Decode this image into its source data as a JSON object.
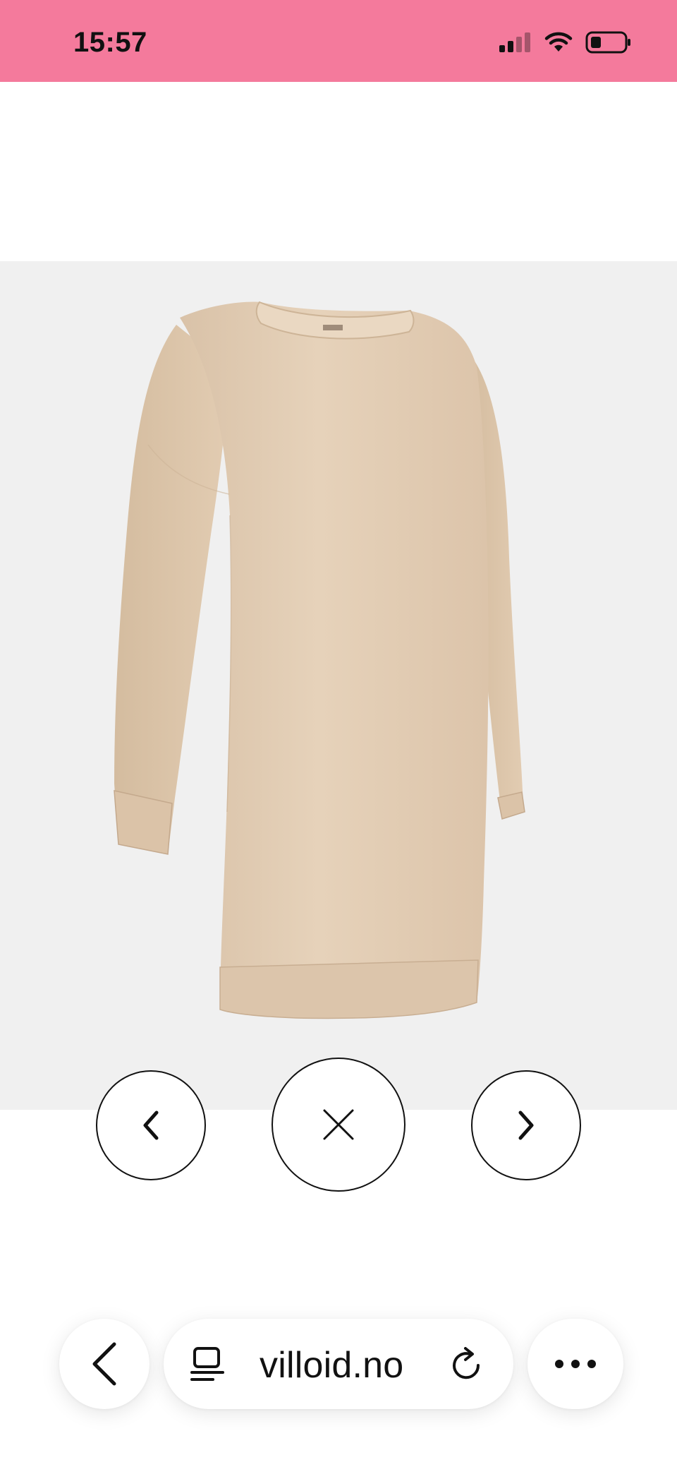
{
  "status_bar": {
    "time": "15:57",
    "background_color": "#f47a9c",
    "icons": [
      "cellular-signal-icon",
      "wifi-icon",
      "battery-icon"
    ]
  },
  "product_viewer": {
    "image": "beige oversized sweatshirt dress, side view",
    "background_color": "#f0f0f0",
    "controls": {
      "previous_icon": "chevron-left-icon",
      "close_icon": "close-icon",
      "next_icon": "chevron-right-icon"
    }
  },
  "browser": {
    "url": "villoid.no",
    "back_icon": "back-arrow-icon",
    "reader_icon": "reader-mode-icon",
    "reload_icon": "reload-icon",
    "more_icon": "more-dots-icon"
  }
}
